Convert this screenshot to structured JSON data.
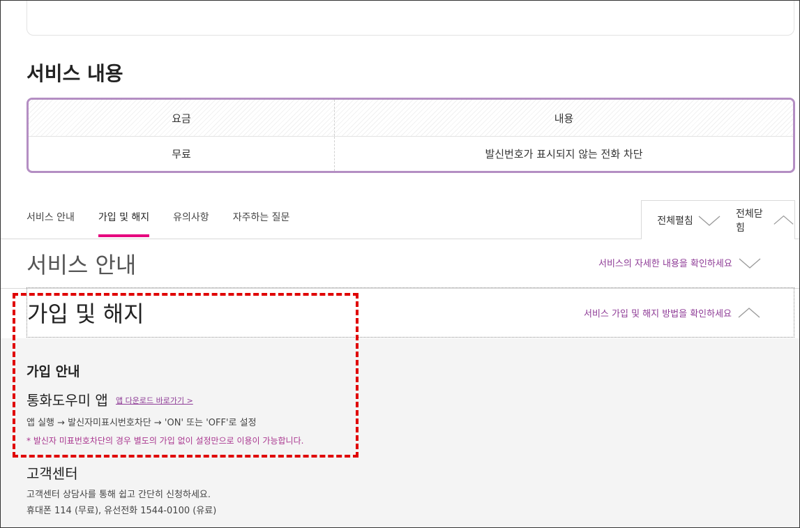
{
  "top": {
    "price": "무료"
  },
  "section": {
    "title": "서비스 내용"
  },
  "table": {
    "headers": [
      "요금",
      "내용"
    ],
    "row": [
      "무료",
      "발신번호가 표시되지 않는 전화 차단"
    ]
  },
  "tabs": [
    {
      "label": "서비스 안내"
    },
    {
      "label": "가입 및 해지"
    },
    {
      "label": "유의사항"
    },
    {
      "label": "자주하는 질문"
    }
  ],
  "controls": {
    "expand_all": "전체펼침",
    "collapse_all": "전체닫힘"
  },
  "accordion": {
    "service_guide": {
      "title": "서비스 안내",
      "desc": "서비스의 자세한 내용을 확인하세요"
    },
    "join_cancel": {
      "title": "가입 및 해지",
      "desc": "서비스 가입 및 해지 방법을 확인하세요"
    }
  },
  "join": {
    "heading": "가입 안내",
    "app_name": "통화도우미 앱",
    "app_link": "앱 다운로드 바로가기 >",
    "steps": "앱 실행 → 발신자미표시번호차단 → 'ON' 또는 'OFF'로 설정",
    "note": "* 발신자 미표번호차단의 경우 별도의 가입 없이 설정만으로 이용이 가능합니다."
  },
  "cs": {
    "title": "고객센터",
    "line1": "고객센터 상담사를 통해 쉽고 간단히 신청하세요.",
    "line2": "휴대폰 114 (무료), 유선전화 1544-0100 (유료)"
  },
  "colors": {
    "accent": "#e6007e",
    "border_purple": "#b48ec3",
    "link_purple": "#8e3b96",
    "highlight": "#e00000"
  }
}
